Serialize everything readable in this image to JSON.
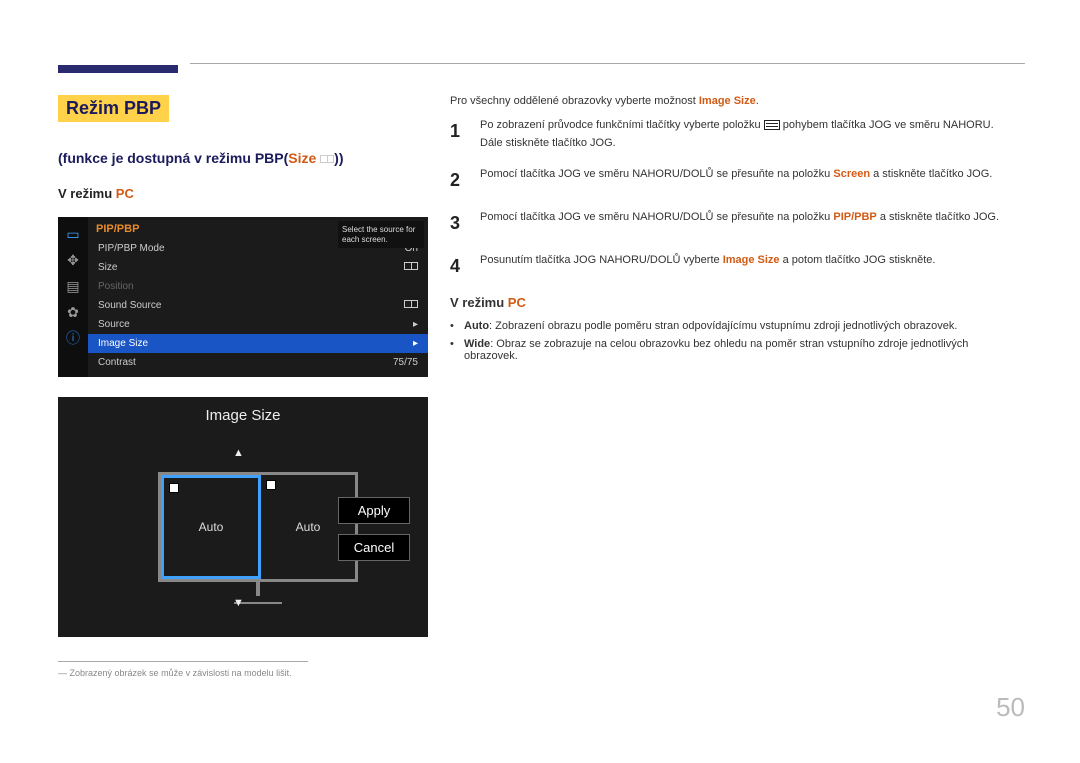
{
  "page_number": "50",
  "heading": "Režim PBP",
  "subtitle_prefix": "(funkce je dostupná v režimu PBP(",
  "subtitle_hl": "Size",
  "subtitle_suffix": "))",
  "mode_label_prefix": "V režimu ",
  "mode_label_hl": "PC",
  "osd": {
    "header": "PIP/PBP",
    "tip": "Select the source for each screen.",
    "rows": [
      {
        "label": "PIP/PBP Mode",
        "value": "On"
      },
      {
        "label": "Size",
        "value": ""
      },
      {
        "label": "Position",
        "value": ""
      },
      {
        "label": "Sound Source",
        "value": ""
      },
      {
        "label": "Source",
        "value": "▸"
      },
      {
        "label": "Image Size",
        "value": "▸"
      },
      {
        "label": "Contrast",
        "value": "75/75"
      }
    ]
  },
  "preview": {
    "title": "Image Size",
    "left": "Auto",
    "right": "Auto",
    "apply": "Apply",
    "cancel": "Cancel"
  },
  "footnote_marker": "―",
  "footnote": "Zobrazený obrázek se může v závislosti na modelu lišit.",
  "intro_prefix": "Pro všechny oddělené obrazovky vyberte možnost ",
  "intro_hl": "Image Size",
  "intro_suffix": ".",
  "steps": [
    {
      "num": "1",
      "pre": "Po zobrazení průvodce funkčními tlačítky vyberte položku ",
      "post": " pohybem tlačítka JOG ve směru NAHORU. Dále stiskněte tlačítko JOG.",
      "icon": true
    },
    {
      "num": "2",
      "pre": "Pomocí tlačítka JOG ve směru NAHORU/DOLŮ se přesuňte na položku ",
      "hl": "Screen",
      "post": " a stiskněte tlačítko JOG."
    },
    {
      "num": "3",
      "pre": "Pomocí tlačítka JOG ve směru NAHORU/DOLŮ se přesuňte na položku ",
      "hl": "PIP/PBP",
      "post": " a stiskněte tlačítko JOG."
    },
    {
      "num": "4",
      "pre": "Posunutím tlačítka JOG NAHORU/DOLŮ vyberte ",
      "hl": "Image Size",
      "post": " a potom tlačítko JOG stiskněte."
    }
  ],
  "bullets": [
    {
      "b": "Auto",
      "t": ": Zobrazení obrazu podle poměru stran odpovídajícímu vstupnímu zdroji jednotlivých obrazovek."
    },
    {
      "b": "Wide",
      "t": ": Obraz se zobrazuje na celou obrazovku bez ohledu na poměr stran vstupního zdroje jednotlivých obrazovek."
    }
  ]
}
